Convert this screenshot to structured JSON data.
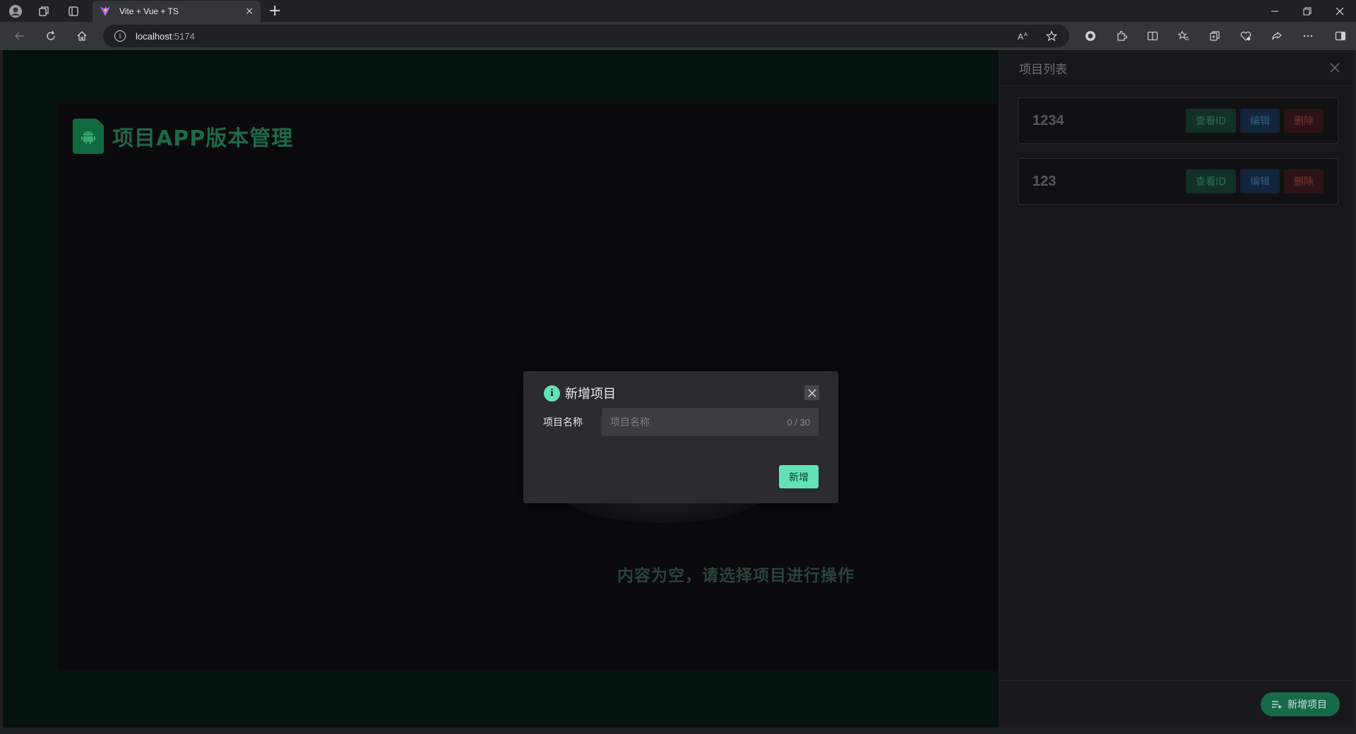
{
  "browser": {
    "tab_title": "Vite + Vue + TS",
    "url_host": "localhost",
    "url_port": ":5174",
    "new_tab": "+",
    "tab_close": "×"
  },
  "app": {
    "title": "项目APP版本管理",
    "empty_text": "内容为空，请选择项目进行操作"
  },
  "drawer": {
    "title": "项目列表",
    "projects": [
      {
        "name": "1234",
        "view_id_label": "查看ID",
        "edit_label": "编辑",
        "delete_label": "删除"
      },
      {
        "name": "123",
        "view_id_label": "查看ID",
        "edit_label": "编辑",
        "delete_label": "删除"
      }
    ],
    "add_label": "新增项目"
  },
  "modal": {
    "title": "新增项目",
    "field_label": "项目名称",
    "placeholder": "项目名称",
    "counter": "0 / 30",
    "submit_label": "新增"
  },
  "colors": {
    "accent": "#63e2b7",
    "brand_green": "#1e6848",
    "page_bg": "#06120e"
  }
}
